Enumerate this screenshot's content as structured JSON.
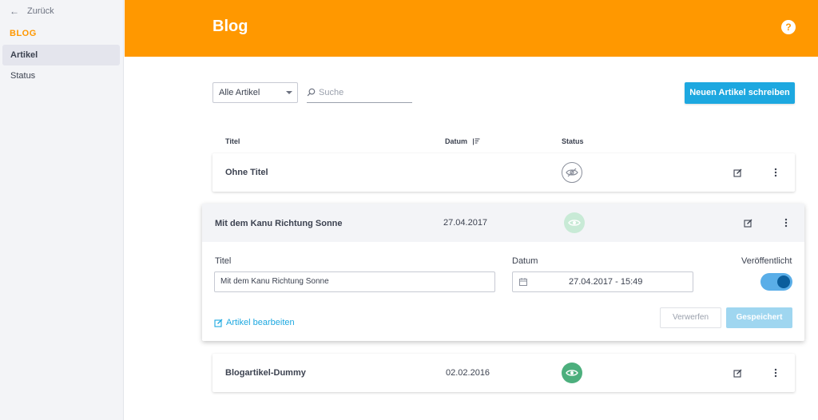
{
  "sidebar": {
    "back_label": "Zurück",
    "heading": "BLOG",
    "items": [
      {
        "label": "Artikel",
        "active": true
      },
      {
        "label": "Status",
        "active": false
      }
    ]
  },
  "header": {
    "title": "Blog",
    "help_label": "?"
  },
  "toolbar": {
    "filter_value": "Alle Artikel",
    "search_placeholder": "Suche",
    "new_button_label": "Neuen Artikel schreiben"
  },
  "columns": {
    "title": "Titel",
    "date": "Datum",
    "status": "Status"
  },
  "rows": [
    {
      "title": "Ohne Titel",
      "date": "",
      "status": "unpublished"
    },
    {
      "title": "Mit dem Kanu Richtung Sonne",
      "date": "27.04.2017",
      "status": "published"
    },
    {
      "title": "Blogartikel-Dummy",
      "date": "02.02.2016",
      "status": "published"
    }
  ],
  "editor": {
    "title_label": "Titel",
    "title_value": "Mit dem Kanu Richtung Sonne",
    "date_label": "Datum",
    "date_value": "27.04.2017 - 15:49",
    "published_label": "Veröffentlicht",
    "published": true,
    "edit_link_label": "Artikel bearbeiten",
    "discard_label": "Verwerfen",
    "saved_label": "Gespeichert"
  },
  "colors": {
    "header": "#ff9800",
    "primary": "#1da8e0",
    "published": "#4caf7d"
  }
}
